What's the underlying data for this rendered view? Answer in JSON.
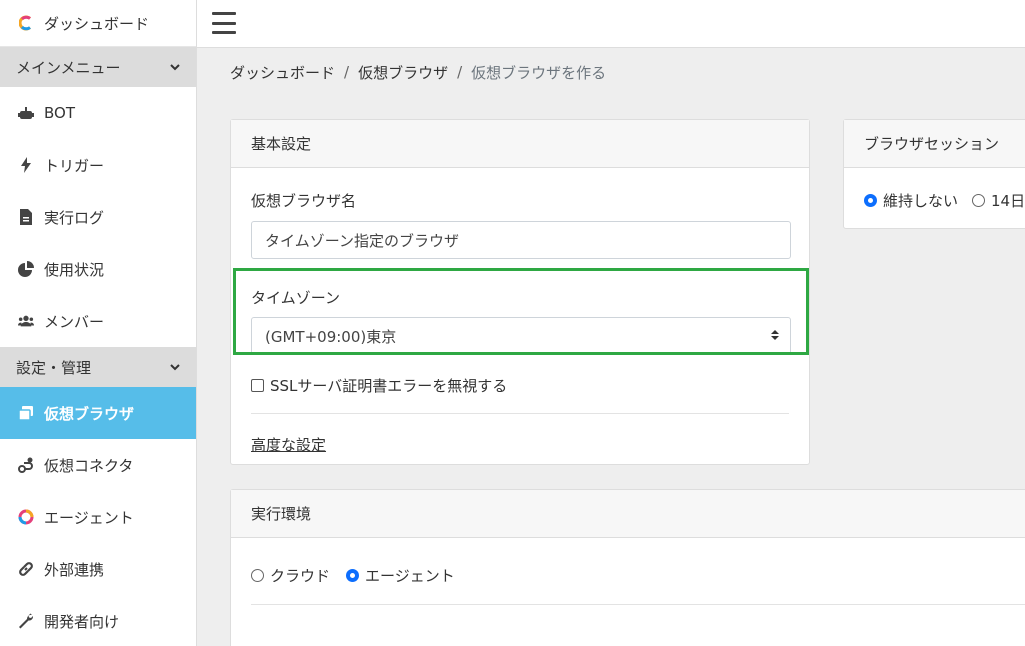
{
  "sidebar": {
    "brand": {
      "label": "ダッシュボード",
      "icon": "brand-logo-icon"
    },
    "sections": [
      {
        "label": "メインメニュー",
        "icon": "chevron-down-icon"
      },
      {
        "label": "設定・管理",
        "icon": "chevron-down-icon"
      }
    ],
    "main_items": [
      {
        "label": "BOT",
        "icon": "robot-icon"
      },
      {
        "label": "トリガー",
        "icon": "bolt-icon"
      },
      {
        "label": "実行ログ",
        "icon": "file-icon"
      },
      {
        "label": "使用状況",
        "icon": "pie-chart-icon"
      },
      {
        "label": "メンバー",
        "icon": "users-icon"
      }
    ],
    "settings_items": [
      {
        "label": "仮想ブラウザ",
        "icon": "copy-icon",
        "active": true
      },
      {
        "label": "仮想コネクタ",
        "icon": "route-icon"
      },
      {
        "label": "エージェント",
        "icon": "agent-logo-icon"
      },
      {
        "label": "外部連携",
        "icon": "link-icon"
      },
      {
        "label": "開発者向け",
        "icon": "wrench-icon"
      }
    ],
    "colors": {
      "active_bg": "#56bde9",
      "section_bg": "#dcdcdc"
    }
  },
  "topbar": {
    "menu_icon": "hamburger-icon"
  },
  "breadcrumb": {
    "items": [
      "ダッシュボード",
      "仮想ブラウザ",
      "仮想ブラウザを作る"
    ],
    "separator": "/"
  },
  "basic_settings": {
    "title": "基本設定",
    "name_label": "仮想ブラウザ名",
    "name_value": "タイムゾーン指定のブラウザ",
    "timezone_label": "タイムゾーン",
    "timezone_value": "(GMT+09:00)東京",
    "ssl_label": "SSLサーバ証明書エラーを無視する",
    "ssl_checked": false,
    "advanced_link": "高度な設定",
    "highlight_color": "#2ea843"
  },
  "browser_session": {
    "title": "ブラウザセッション",
    "options": [
      {
        "label": "維持しない",
        "selected": true
      },
      {
        "label": "14日",
        "selected": false
      }
    ]
  },
  "execution_env": {
    "title": "実行環境",
    "options": [
      {
        "label": "クラウド",
        "selected": false
      },
      {
        "label": "エージェント",
        "selected": true
      }
    ]
  }
}
